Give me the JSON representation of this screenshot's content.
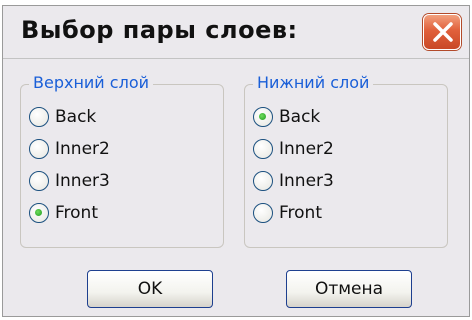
{
  "dialog": {
    "title": "Выбор пары слоев:",
    "accent": "#1a5fd8",
    "close_color": "#e1603b"
  },
  "groups": [
    {
      "legend": "Верхний слой",
      "options": [
        {
          "label": "Back",
          "selected": false
        },
        {
          "label": "Inner2",
          "selected": false
        },
        {
          "label": "Inner3",
          "selected": false
        },
        {
          "label": "Front",
          "selected": true
        }
      ]
    },
    {
      "legend": "Нижний слой",
      "options": [
        {
          "label": "Back",
          "selected": true
        },
        {
          "label": "Inner2",
          "selected": false
        },
        {
          "label": "Inner3",
          "selected": false
        },
        {
          "label": "Front",
          "selected": false
        }
      ]
    }
  ],
  "buttons": {
    "ok_label": "OK",
    "cancel_label": "Отмена"
  },
  "icons": {
    "close": "close-icon",
    "radio": "radio-button"
  }
}
